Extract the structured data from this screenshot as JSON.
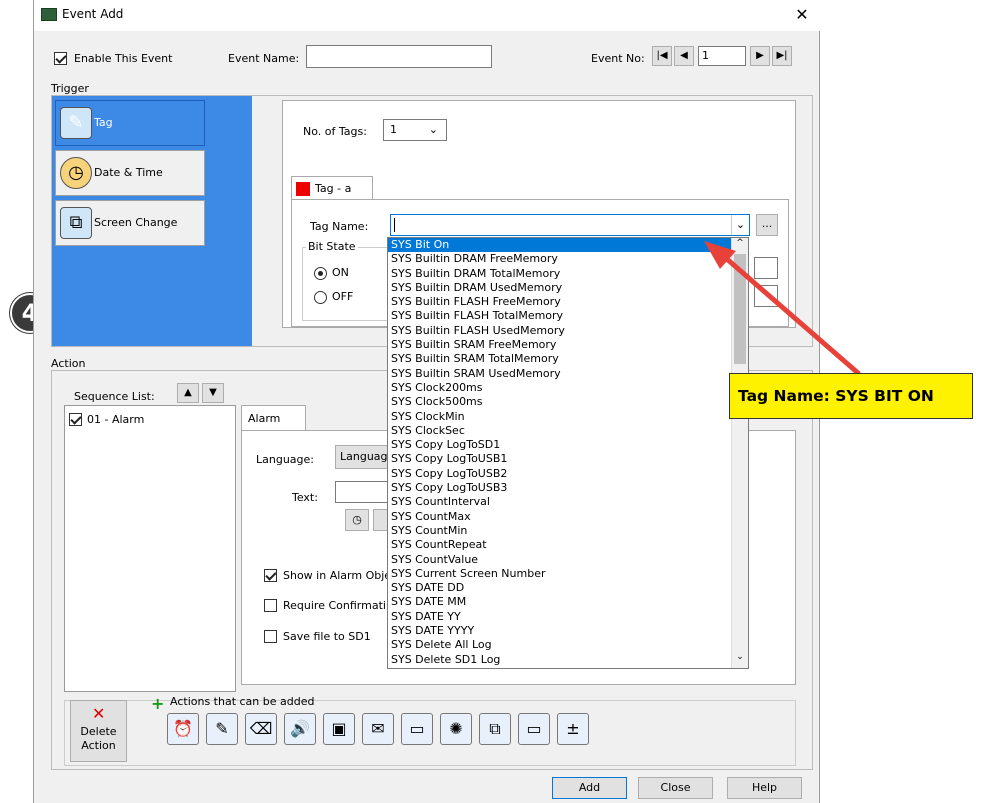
{
  "window": {
    "title": "Event Add"
  },
  "header": {
    "enable_label": "Enable This Event",
    "enable_checked": true,
    "event_name_label": "Event Name:",
    "event_name_value": "",
    "event_no_label": "Event No:",
    "event_no_value": "1"
  },
  "trigger": {
    "section_label": "Trigger",
    "items": [
      {
        "label": "Tag",
        "icon": "tag-icon"
      },
      {
        "label": "Date & Time",
        "icon": "clock-icon"
      },
      {
        "label": "Screen Change",
        "icon": "screen-change-icon"
      }
    ],
    "no_of_tags_label": "No. of Tags:",
    "no_of_tags_value": "1",
    "tag_tab_label": "Tag - a",
    "tag_name_label": "Tag Name:",
    "tag_name_value": "",
    "browse_label": "...",
    "bit_state_label": "Bit State",
    "on_label": "ON",
    "off_label": "OFF"
  },
  "tag_dropdown": {
    "items": [
      "SYS Bit On",
      "SYS Builtin DRAM FreeMemory",
      "SYS Builtin DRAM TotalMemory",
      "SYS Builtin DRAM UsedMemory",
      "SYS Builtin FLASH FreeMemory",
      "SYS Builtin FLASH TotalMemory",
      "SYS Builtin FLASH UsedMemory",
      "SYS Builtin SRAM FreeMemory",
      "SYS Builtin SRAM TotalMemory",
      "SYS Builtin SRAM UsedMemory",
      "SYS Clock200ms",
      "SYS Clock500ms",
      "SYS ClockMin",
      "SYS ClockSec",
      "SYS Copy LogToSD1",
      "SYS Copy LogToUSB1",
      "SYS Copy LogToUSB2",
      "SYS Copy LogToUSB3",
      "SYS CountInterval",
      "SYS CountMax",
      "SYS CountMin",
      "SYS CountRepeat",
      "SYS CountValue",
      "SYS Current Screen Number",
      "SYS DATE DD",
      "SYS DATE MM",
      "SYS DATE YY",
      "SYS DATE YYYY",
      "SYS Delete All Log",
      "SYS Delete SD1 Log"
    ],
    "selected_index": 0
  },
  "action": {
    "section_label": "Action",
    "sequence_list_label": "Sequence List:",
    "sequence_items": [
      {
        "label": "01 - Alarm",
        "checked": true
      }
    ],
    "tab_label": "Alarm",
    "language_label": "Language:",
    "language_value": "Languag",
    "text_label": "Text:",
    "show_in_alarm_label": "Show in Alarm Obje",
    "show_in_alarm_checked": true,
    "require_confirm_label": "Require Confirmati",
    "require_confirm_checked": false,
    "save_file_label": "Save file to SD1",
    "save_file_checked": false,
    "actions_can_add_label": "Actions that can be added",
    "delete_action_label_1": "Delete",
    "delete_action_label_2": "Action"
  },
  "footer": {
    "add": "Add",
    "close": "Close",
    "help": "Help"
  },
  "annotation": {
    "callout_text": "Tag Name: SYS BIT ON",
    "step_number": "4"
  },
  "colors": {
    "selection_blue": "#3d89e6",
    "callout_yellow": "#fff200",
    "arrow_red": "#e8413a"
  }
}
